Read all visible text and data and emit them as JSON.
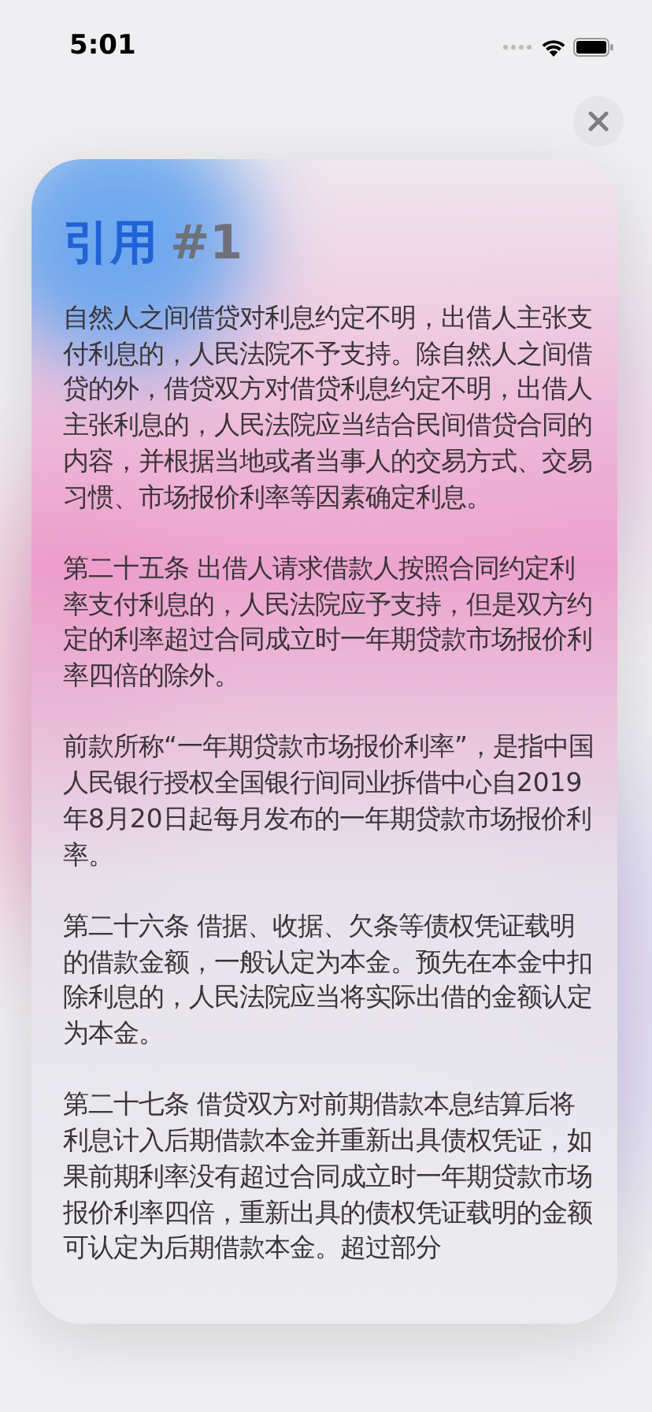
{
  "status_bar": {
    "time": "5:01"
  },
  "title": {
    "text": "引用",
    "number": "#1"
  },
  "paragraphs": [
    "自然人之间借贷对利息约定不明，出借人主张支付利息的，人民法院不予支持。除自然人之间借贷的外，借贷双方对借贷利息约定不明，出借人主张利息的，人民法院应当结合民间借贷合同的内容，并根据当地或者当事人的交易方式、交易习惯、市场报价利率等因素确定利息。",
    "第二十五条 出借人请求借款人按照合同约定利率支付利息的，人民法院应予支持，但是双方约定的利率超过合同成立时一年期贷款市场报价利率四倍的除外。",
    "前款所称“一年期贷款市场报价利率”，是指中国人民银行授权全国银行间同业拆借中心自2019年8月20日起每月发布的一年期贷款市场报价利率。",
    "第二十六条 借据、收据、欠条等债权凭证载明的借款金额，一般认定为本金。预先在本金中扣除利息的，人民法院应当将实际出借的金额认定为本金。",
    "第二十七条 借贷双方对前期借款本息结算后将利息计入后期借款本金并重新出具债权凭证，如果前期利率没有超过合同成立时一年期贷款市场报价利率四倍，重新出具的债权凭证载明的金额可认定为后期借款本金。超过部分"
  ]
}
